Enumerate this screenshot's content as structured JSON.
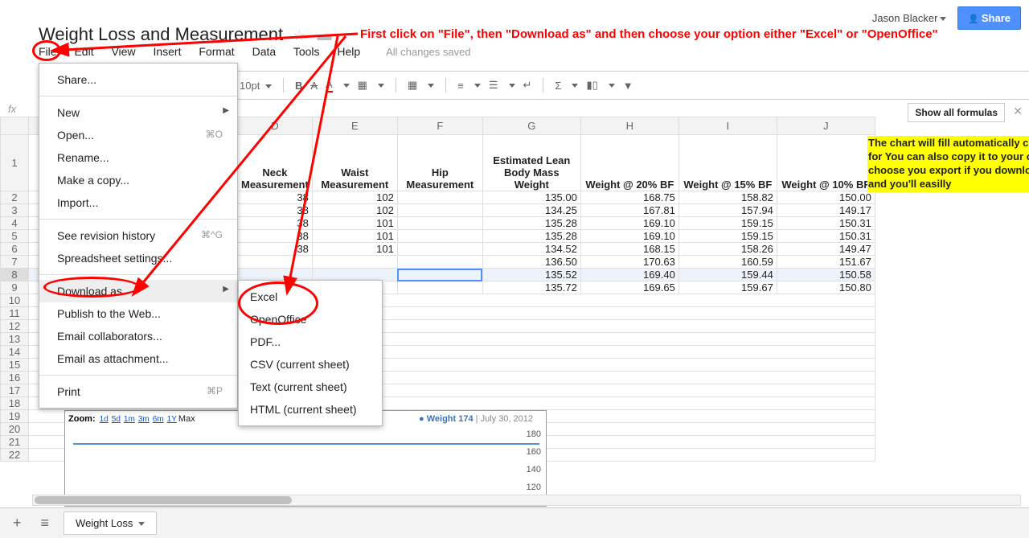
{
  "user": "Jason Blacker",
  "share": "Share",
  "title": "Weight Loss and Measurement",
  "annotation": "First click on \"File\", then \"Download as\" and then choose your option either \"Excel\" or \"OpenOffice\"",
  "menubar": [
    "File",
    "Edit",
    "View",
    "Insert",
    "Format",
    "Data",
    "Tools",
    "Help"
  ],
  "saved": "All changes saved",
  "fontsize": "10pt",
  "fx": "fx",
  "showformulas": "Show all formulas",
  "filemenu": {
    "share": "Share...",
    "new": "New",
    "open": "Open...",
    "open_sc": "⌘O",
    "rename": "Rename...",
    "copy": "Make a copy...",
    "import": "Import...",
    "revision": "See revision history",
    "revision_sc": "⌘^G",
    "settings": "Spreadsheet settings...",
    "download": "Download as",
    "publish": "Publish to the Web...",
    "collab": "Email collaborators...",
    "attach": "Email as attachment...",
    "print": "Print",
    "print_sc": "⌘P"
  },
  "submenu": [
    "Excel",
    "OpenOffice",
    "PDF...",
    "CSV (current sheet)",
    "Text (current sheet)",
    "HTML (current sheet)"
  ],
  "columns": [
    "D",
    "E",
    "F",
    "G",
    "H",
    "I",
    "J"
  ],
  "headers": [
    "Neck\nMeasurement",
    "Waist\nMeasurement",
    "Hip\nMeasurement",
    "Estimated Lean\nBody Mass\nWeight",
    "Weight @ 20% BF",
    "Weight @ 15% BF",
    "Weight @ 10% BF"
  ],
  "rows": [
    [
      "38",
      "102",
      "",
      "135.00",
      "168.75",
      "158.82",
      "150.00"
    ],
    [
      "38",
      "102",
      "",
      "134.25",
      "167.81",
      "157.94",
      "149.17"
    ],
    [
      "38",
      "101",
      "",
      "135.28",
      "169.10",
      "159.15",
      "150.31"
    ],
    [
      "38",
      "101",
      "",
      "135.28",
      "169.10",
      "159.15",
      "150.31"
    ],
    [
      "38",
      "101",
      "",
      "134.52",
      "168.15",
      "158.26",
      "149.47"
    ],
    [
      "",
      "",
      "",
      "136.50",
      "170.63",
      "160.59",
      "151.67"
    ],
    [
      "",
      "",
      "",
      "135.52",
      "169.40",
      "159.44",
      "150.58"
    ],
    [
      "",
      "",
      "",
      "135.72",
      "169.65",
      "159.67",
      "150.80"
    ]
  ],
  "note": "The chart will fill automatically choose to export this to use for You can also copy it to your ow \"Copy to\" and then choose you export if you download the spre choose chart and you'll easilly",
  "chart": {
    "zoom": "Zoom:",
    "ranges": [
      "1d",
      "5d",
      "1m",
      "3m",
      "6m",
      "1Y",
      "Max"
    ],
    "legend_w": "Weight 174",
    "legend_d": "| July 30, 2012",
    "ylabels": [
      "180",
      "160",
      "140",
      "120"
    ]
  },
  "tab": "Weight Loss",
  "chart_data": {
    "type": "line",
    "title": "Weight",
    "series": [
      {
        "name": "Weight",
        "values": [
          176,
          175,
          174,
          174,
          173,
          174
        ]
      }
    ],
    "ylim": [
      120,
      180
    ],
    "legend": "Weight 174",
    "date": "July 30, 2012"
  }
}
